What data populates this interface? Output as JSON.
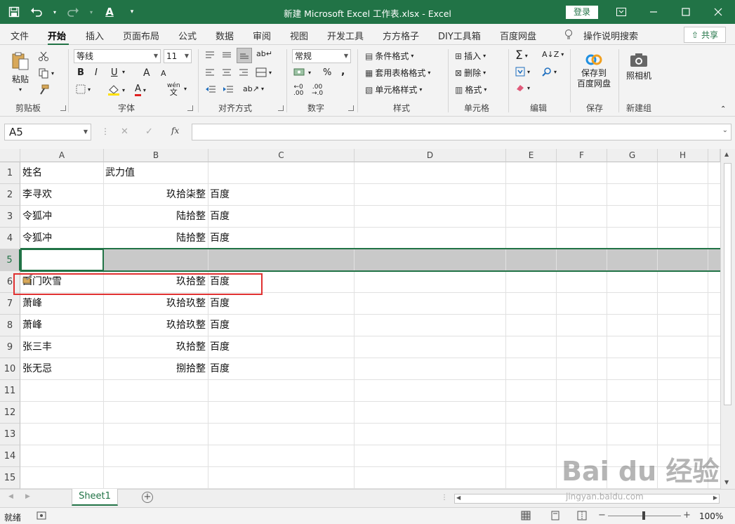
{
  "window": {
    "title": "新建 Microsoft Excel 工作表.xlsx  -  Excel",
    "login": "登录"
  },
  "tabs": [
    "文件",
    "开始",
    "插入",
    "页面布局",
    "公式",
    "数据",
    "审阅",
    "视图",
    "开发工具",
    "方方格子",
    "DIY工具箱",
    "百度网盘",
    "操作说明搜索"
  ],
  "active_tab": "开始",
  "share": "共享",
  "ribbon": {
    "clipboard": {
      "label": "剪贴板",
      "paste": "粘贴"
    },
    "font": {
      "label": "字体",
      "name": "等线",
      "size": "11",
      "bold": "B",
      "italic": "I",
      "underline": "U",
      "grow": "A",
      "shrink": "A",
      "phonetic": "wén"
    },
    "alignment": {
      "label": "对齐方式"
    },
    "number": {
      "label": "数字",
      "format": "常规"
    },
    "styles": {
      "label": "样式",
      "conditional": "条件格式",
      "table": "套用表格格式",
      "cell_styles": "单元格样式"
    },
    "cells": {
      "label": "单元格",
      "insert": "插入",
      "delete": "删除",
      "format": "格式"
    },
    "editing": {
      "label": "编辑"
    },
    "save": {
      "label": "保存",
      "button_line1": "保存到",
      "button_line2": "百度网盘"
    },
    "newgroup": {
      "label": "新建组",
      "camera": "照相机"
    }
  },
  "formula": {
    "namebox": "A5",
    "content": ""
  },
  "columns": [
    "A",
    "B",
    "C",
    "D",
    "E",
    "F",
    "G",
    "H"
  ],
  "rows": [
    {
      "num": "1",
      "a": "姓名",
      "b": "武力值",
      "c": ""
    },
    {
      "num": "2",
      "a": "李寻欢",
      "b": "玖拾柒整",
      "c": "百度"
    },
    {
      "num": "3",
      "a": "令狐冲",
      "b": "陆拾整",
      "c": "百度"
    },
    {
      "num": "4",
      "a": "令狐冲",
      "b": "陆拾整",
      "c": "百度"
    },
    {
      "num": "5",
      "a": "",
      "b": "",
      "c": ""
    },
    {
      "num": "6",
      "a": "西门吹雪",
      "b": "玖拾整",
      "c": "百度"
    },
    {
      "num": "7",
      "a": "萧峰",
      "b": "玖拾玖整",
      "c": "百度"
    },
    {
      "num": "8",
      "a": "萧峰",
      "b": "玖拾玖整",
      "c": "百度"
    },
    {
      "num": "9",
      "a": "张三丰",
      "b": "玖拾整",
      "c": "百度"
    },
    {
      "num": "10",
      "a": "张无忌",
      "b": "捌拾整",
      "c": "百度"
    },
    {
      "num": "11",
      "a": "",
      "b": "",
      "c": ""
    },
    {
      "num": "12",
      "a": "",
      "b": "",
      "c": ""
    },
    {
      "num": "13",
      "a": "",
      "b": "",
      "c": ""
    },
    {
      "num": "14",
      "a": "",
      "b": "",
      "c": ""
    },
    {
      "num": "15",
      "a": "",
      "b": "",
      "c": ""
    }
  ],
  "sheet": {
    "name": "Sheet1"
  },
  "status": {
    "text": "就绪",
    "zoom": "100%"
  },
  "watermark": {
    "main": "Bai du 经验",
    "sub": "jingyan.baidu.com"
  },
  "colors": {
    "accent": "#217346",
    "highlight": "#e03131",
    "selection": "#c9c9c9"
  }
}
